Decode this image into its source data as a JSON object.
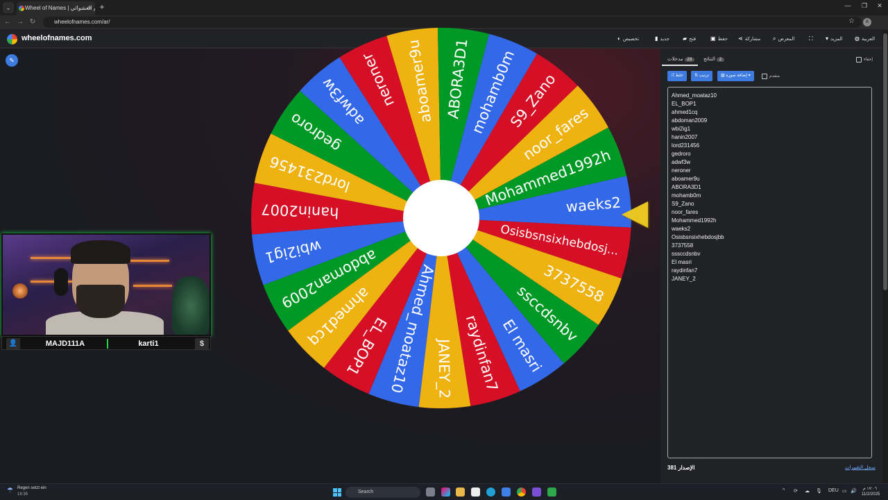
{
  "browser": {
    "tab_title": "Wheel of Names | الاسم العشوائي",
    "url": "wheelofnames.com/ar/"
  },
  "site": {
    "name": "wheelofnames.com",
    "menu": [
      "تخصيص",
      "جديد",
      "فتح",
      "حفظ",
      "مشاركة",
      "المعرض",
      "المزيد",
      "العربية"
    ]
  },
  "wheel": {
    "segments": [
      {
        "name": "Ahmed_moataz10",
        "color": "#3369e8"
      },
      {
        "name": "EL_BOP1",
        "color": "#d50f25"
      },
      {
        "name": "ahmed1cq",
        "color": "#eeb211"
      },
      {
        "name": "abdoman2009",
        "color": "#009925"
      },
      {
        "name": "wbi2ig1",
        "color": "#3369e8"
      },
      {
        "name": "hanin2007",
        "color": "#d50f25"
      },
      {
        "name": "lord231456",
        "color": "#eeb211"
      },
      {
        "name": "gedroro",
        "color": "#009925"
      },
      {
        "name": "adwf3w",
        "color": "#3369e8"
      },
      {
        "name": "neroner",
        "color": "#d50f25"
      },
      {
        "name": "aboamer9u",
        "color": "#eeb211"
      },
      {
        "name": "ABORA3D1",
        "color": "#009925"
      },
      {
        "name": "mohamb0m",
        "color": "#3369e8"
      },
      {
        "name": "S9_Zano",
        "color": "#d50f25"
      },
      {
        "name": "noor_fares",
        "color": "#eeb211"
      },
      {
        "name": "Mohammed1992h",
        "color": "#009925"
      },
      {
        "name": "waeks2",
        "color": "#3369e8"
      },
      {
        "name": "Osisbsnsixhebdosj...",
        "color": "#d50f25"
      },
      {
        "name": "3737558",
        "color": "#eeb211"
      },
      {
        "name": "ssccdsnbv",
        "color": "#009925"
      },
      {
        "name": "El masri",
        "color": "#3369e8"
      },
      {
        "name": "raydinfan7",
        "color": "#d50f25"
      },
      {
        "name": "JANEY_2",
        "color": "#eeb211"
      }
    ],
    "pointer_color": "#e8c523"
  },
  "webcam": {
    "name_left": "MAJD111A",
    "name_right": "karti1",
    "user_icon": "person-icon",
    "dollar_icon": "$"
  },
  "panel": {
    "tabs": {
      "entries_label": "مدخلات",
      "entries_count": "23",
      "results_label": "النتائج",
      "results_count": "2"
    },
    "hide_label": "إخفاء",
    "buttons": {
      "shuffle": "خلط",
      "sort": "ترتيب",
      "add_image": "إضافة صورة"
    },
    "advanced_label": "متقدم",
    "entries": [
      "Ahmed_moataz10",
      "EL_BOP1",
      "ahmed1cq",
      "abdoman2009",
      "wbi2ig1",
      "hanin2007",
      "lord231456",
      "gedroro",
      "adwf3w",
      "neroner",
      "aboamer9u",
      "ABORA3D1",
      "mohamb0m",
      "S9_Zano",
      "noor_fares",
      "Mohammed1992h",
      "waeks2",
      "Osisbsnsixhebdosjbb",
      "3737558",
      "sssccdsnbv",
      "El masri",
      "raydinfan7",
      "JANEY_2"
    ],
    "version_label": "الإصدار 381",
    "changelog_link": "سجل التغييرات"
  },
  "taskbar": {
    "weather_line1": "Regen setzt ein",
    "weather_line2": "18:36",
    "search_placeholder": "Search",
    "lang": "DEU",
    "time": "١٧:٠٦ م",
    "date": "11/2/2025"
  }
}
